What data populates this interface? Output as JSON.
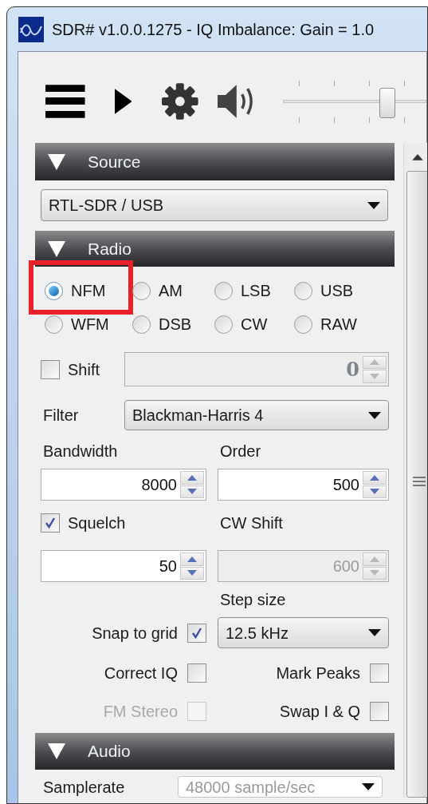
{
  "window": {
    "title": "SDR# v1.0.0.1275 - IQ Imbalance: Gain = 1.0"
  },
  "toolbar": {
    "volume": {
      "level": 0.75
    }
  },
  "sections": [
    {
      "kind": "source",
      "title": "Source",
      "expanded": true,
      "device": "RTL-SDR / USB"
    },
    {
      "kind": "radio",
      "title": "Radio",
      "expanded": true,
      "modes": [
        {
          "label": "NFM",
          "selected": true,
          "highlighted": true
        },
        {
          "label": "AM",
          "selected": false,
          "highlighted": false
        },
        {
          "label": "LSB",
          "selected": false,
          "highlighted": false
        },
        {
          "label": "USB",
          "selected": false,
          "highlighted": false
        },
        {
          "label": "WFM",
          "selected": false,
          "highlighted": false
        },
        {
          "label": "DSB",
          "selected": false,
          "highlighted": false
        },
        {
          "label": "CW",
          "selected": false,
          "highlighted": false
        },
        {
          "label": "RAW",
          "selected": false,
          "highlighted": false
        }
      ],
      "shift": {
        "label": "Shift",
        "checked": false,
        "value": "0",
        "disabled": true
      },
      "filter": {
        "label": "Filter",
        "value": "Blackman-Harris 4"
      },
      "bandwidth": {
        "label": "Bandwidth",
        "value": "8000",
        "disabled": false
      },
      "order": {
        "label": "Order",
        "value": "500",
        "disabled": false
      },
      "squelch": {
        "label": "Squelch",
        "checked": true,
        "value": "50",
        "disabled": false
      },
      "cw_shift": {
        "label": "CW Shift",
        "value": "600",
        "disabled": true
      },
      "step_size": {
        "label": "Step size",
        "value": "12.5 kHz"
      },
      "options": [
        {
          "label": "Snap to grid",
          "checked": true,
          "disabled": false
        },
        {
          "label": "Correct IQ",
          "checked": false,
          "disabled": false
        },
        {
          "label": "Mark Peaks",
          "checked": false,
          "disabled": false
        },
        {
          "label": "FM Stereo",
          "checked": false,
          "disabled": true
        },
        {
          "label": "Swap I & Q",
          "checked": false,
          "disabled": false
        }
      ]
    },
    {
      "kind": "audio",
      "title": "Audio",
      "expanded": true,
      "samplerate": {
        "label": "Samplerate",
        "value": "48000 sample/sec",
        "disabled": true
      }
    }
  ]
}
